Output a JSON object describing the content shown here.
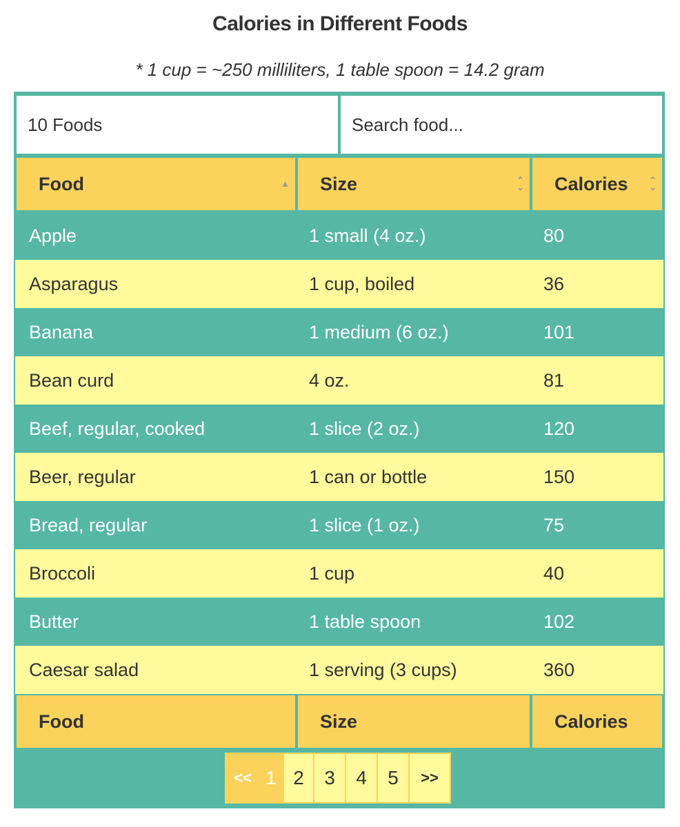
{
  "title": "Calories in Different Foods",
  "subtitle": "* 1 cup = ~250 milliliters, 1 table spoon = 14.2 gram",
  "controls": {
    "count_label": "10 Foods",
    "search_placeholder": "Search food..."
  },
  "columns": [
    {
      "label": "Food",
      "sort": "ascending"
    },
    {
      "label": "Size",
      "sort": "none"
    },
    {
      "label": "Calories",
      "sort": "none"
    }
  ],
  "rows": [
    {
      "food": "Apple",
      "size": "1 small (4 oz.)",
      "calories": "80"
    },
    {
      "food": "Asparagus",
      "size": "1 cup, boiled",
      "calories": "36"
    },
    {
      "food": "Banana",
      "size": "1 medium (6 oz.)",
      "calories": "101"
    },
    {
      "food": "Bean curd",
      "size": "4 oz.",
      "calories": "81"
    },
    {
      "food": "Beef, regular, cooked",
      "size": "1 slice (2 oz.)",
      "calories": "120"
    },
    {
      "food": "Beer, regular",
      "size": "1 can or bottle",
      "calories": "150"
    },
    {
      "food": "Bread, regular",
      "size": "1 slice (1 oz.)",
      "calories": "75"
    },
    {
      "food": "Broccoli",
      "size": "1 cup",
      "calories": "40"
    },
    {
      "food": "Butter",
      "size": "1 table spoon",
      "calories": "102"
    },
    {
      "food": "Caesar salad",
      "size": "1 serving (3 cups)",
      "calories": "360"
    }
  ],
  "footer": [
    "Food",
    "Size",
    "Calories"
  ],
  "pagination": {
    "first": "<<",
    "pages": [
      "1",
      "2",
      "3",
      "4",
      "5"
    ],
    "current": "1",
    "last": ">>"
  },
  "icons": {
    "sort_asc": "▲",
    "sort_both": "⇕"
  },
  "colors": {
    "teal": "#56b7a5",
    "header_yellow": "#fbd35c",
    "row_yellow": "#fffb9c"
  }
}
